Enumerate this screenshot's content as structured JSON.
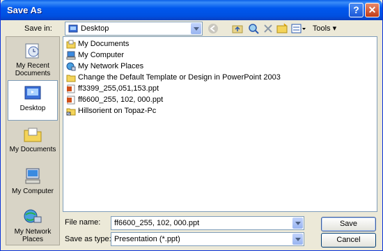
{
  "window": {
    "title": "Save As"
  },
  "save_in": {
    "label": "Save in:",
    "value": "Desktop"
  },
  "toolbar": {
    "tools_label": "Tools"
  },
  "places": [
    {
      "label": "My Recent Documents",
      "icon": "recent-documents-icon"
    },
    {
      "label": "Desktop",
      "icon": "desktop-icon"
    },
    {
      "label": "My Documents",
      "icon": "my-documents-icon"
    },
    {
      "label": "My Computer",
      "icon": "my-computer-icon"
    },
    {
      "label": "My Network Places",
      "icon": "network-places-icon"
    }
  ],
  "files": [
    {
      "name": "My Documents",
      "icon": "my-documents-icon"
    },
    {
      "name": "My Computer",
      "icon": "my-computer-icon"
    },
    {
      "name": "My Network Places",
      "icon": "network-places-icon"
    },
    {
      "name": "Change the Default Template or Design in PowerPoint 2003",
      "icon": "folder-icon"
    },
    {
      "name": "ff3399_255,051,153.ppt",
      "icon": "ppt-file-icon"
    },
    {
      "name": "ff6600_255, 102, 000.ppt",
      "icon": "ppt-file-icon"
    },
    {
      "name": "Hillsorient on Topaz-Pc",
      "icon": "shortcut-icon"
    }
  ],
  "file_name": {
    "label": "File name:",
    "value": "ff6600_255, 102, 000.ppt"
  },
  "save_as_type": {
    "label": "Save as type:",
    "value": "Presentation (*.ppt)"
  },
  "buttons": {
    "save": "Save",
    "cancel": "Cancel"
  }
}
